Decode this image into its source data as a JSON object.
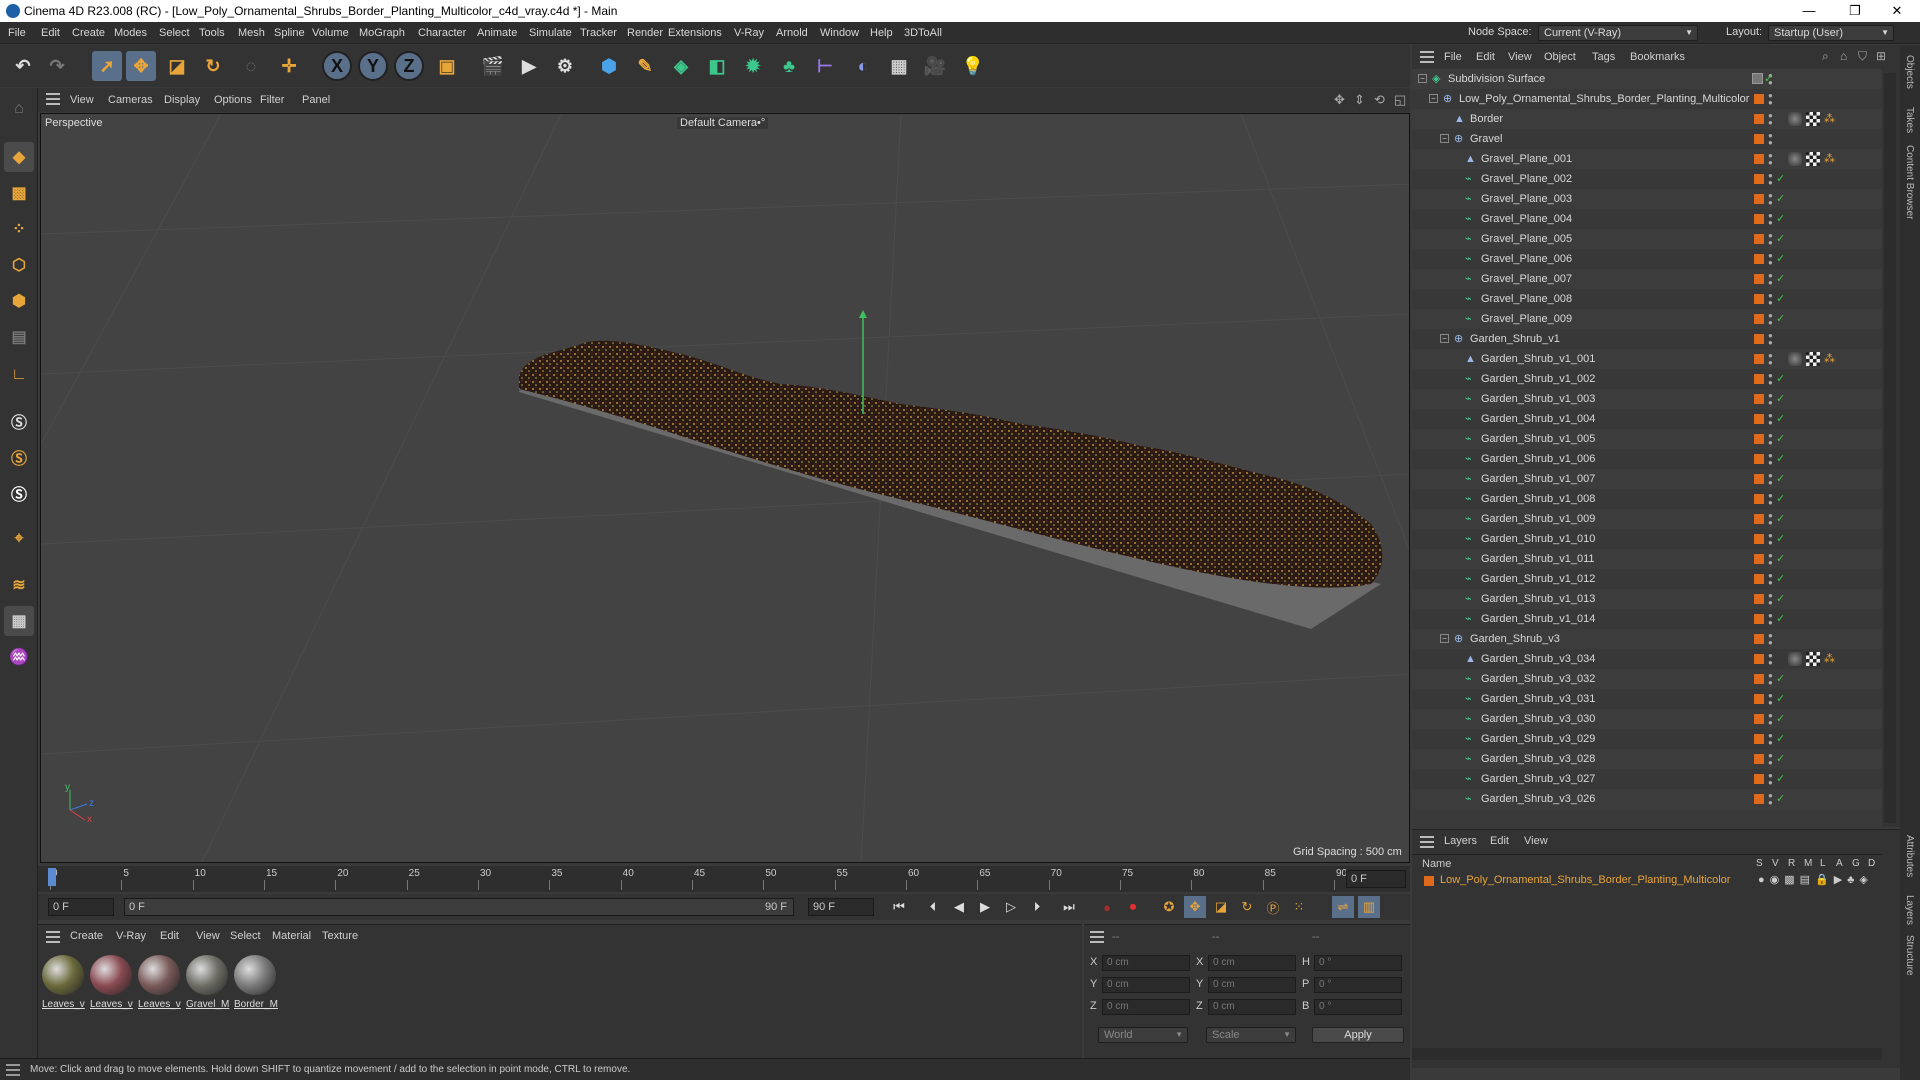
{
  "window": {
    "title": "Cinema 4D R23.008 (RC) - [Low_Poly_Ornamental_Shrubs_Border_Planting_Multicolor_c4d_vray.c4d *] - Main",
    "minimize": "—",
    "maximize": "❐",
    "close": "✕"
  },
  "menu": [
    "File",
    "Edit",
    "Create",
    "Modes",
    "Select",
    "Tools",
    "Mesh",
    "Spline",
    "Volume",
    "MoGraph",
    "Character",
    "Animate",
    "Simulate",
    "Tracker",
    "Render",
    "Extensions",
    "V-Ray",
    "Arnold",
    "Window",
    "Help",
    "3DToAll"
  ],
  "node_space": {
    "label": "Node Space:",
    "value": "Current (V-Ray)"
  },
  "layout": {
    "label": "Layout:",
    "value": "Startup (User)"
  },
  "viewport": {
    "menu": [
      "View",
      "Cameras",
      "Display",
      "Options",
      "Filter",
      "Panel"
    ],
    "label": "Perspective",
    "camera": "Default Camera",
    "camera_suffix": "•°",
    "grid_spacing": "Grid Spacing : 500 cm",
    "axis_y": "y",
    "axis_z": "z",
    "axis_x": "x"
  },
  "timeline": {
    "ticks": [
      "0",
      "5",
      "10",
      "15",
      "20",
      "25",
      "30",
      "35",
      "40",
      "45",
      "50",
      "55",
      "60",
      "65",
      "70",
      "75",
      "80",
      "85",
      "90"
    ],
    "current_frame": "0 F"
  },
  "transport": {
    "start": "0 F",
    "range_start": "0 F",
    "range_end": "90 F",
    "end": "90 F"
  },
  "materials": {
    "menu": [
      "Create",
      "V-Ray",
      "Edit",
      "View",
      "Select",
      "Material",
      "Texture"
    ],
    "items": [
      {
        "label": "Leaves_v",
        "color": "#6b6a3c"
      },
      {
        "label": "Leaves_v",
        "color": "#8a4a52"
      },
      {
        "label": "Leaves_v",
        "color": "#7a5a5a"
      },
      {
        "label": "Gravel_M",
        "color": "#6e6e66"
      },
      {
        "label": "Border_M",
        "color": "#7a7a7a"
      }
    ]
  },
  "coords": {
    "header": [
      "--",
      "--",
      "--"
    ],
    "rows": [
      {
        "a": "X",
        "av": "0 cm",
        "b": "X",
        "bv": "0 cm",
        "c": "H",
        "cv": "0 °"
      },
      {
        "a": "Y",
        "av": "0 cm",
        "b": "Y",
        "bv": "0 cm",
        "c": "P",
        "cv": "0 °"
      },
      {
        "a": "Z",
        "av": "0 cm",
        "b": "Z",
        "bv": "0 cm",
        "c": "B",
        "cv": "0 °"
      }
    ],
    "mode1": "World",
    "mode2": "Scale",
    "apply": "Apply"
  },
  "status": "Move: Click and drag to move elements. Hold down SHIFT to quantize movement / add to the selection in point mode, CTRL to remove.",
  "objects": {
    "menu": [
      "File",
      "Edit",
      "View",
      "Object",
      "Tags",
      "Bookmarks"
    ],
    "rows": [
      {
        "name": "Subdivision Surface",
        "indent": 0,
        "icon": "subdiv",
        "toggle": "minus"
      },
      {
        "name": "Low_Poly_Ornamental_Shrubs_Border_Planting_Multicolor",
        "indent": 1,
        "icon": "null",
        "toggle": "minus"
      },
      {
        "name": "Border",
        "indent": 2,
        "icon": "poly",
        "tags": true
      },
      {
        "name": "Gravel",
        "indent": 2,
        "icon": "null",
        "toggle": "minus"
      },
      {
        "name": "Gravel_Plane_001",
        "indent": 3,
        "icon": "poly",
        "tags": true
      },
      {
        "name": "Gravel_Plane_002",
        "indent": 3,
        "icon": "inst"
      },
      {
        "name": "Gravel_Plane_003",
        "indent": 3,
        "icon": "inst"
      },
      {
        "name": "Gravel_Plane_004",
        "indent": 3,
        "icon": "inst"
      },
      {
        "name": "Gravel_Plane_005",
        "indent": 3,
        "icon": "inst"
      },
      {
        "name": "Gravel_Plane_006",
        "indent": 3,
        "icon": "inst"
      },
      {
        "name": "Gravel_Plane_007",
        "indent": 3,
        "icon": "inst"
      },
      {
        "name": "Gravel_Plane_008",
        "indent": 3,
        "icon": "inst"
      },
      {
        "name": "Gravel_Plane_009",
        "indent": 3,
        "icon": "inst"
      },
      {
        "name": "Garden_Shrub_v1",
        "indent": 2,
        "icon": "null",
        "toggle": "minus"
      },
      {
        "name": "Garden_Shrub_v1_001",
        "indent": 3,
        "icon": "poly",
        "tags": true
      },
      {
        "name": "Garden_Shrub_v1_002",
        "indent": 3,
        "icon": "inst"
      },
      {
        "name": "Garden_Shrub_v1_003",
        "indent": 3,
        "icon": "inst"
      },
      {
        "name": "Garden_Shrub_v1_004",
        "indent": 3,
        "icon": "inst"
      },
      {
        "name": "Garden_Shrub_v1_005",
        "indent": 3,
        "icon": "inst"
      },
      {
        "name": "Garden_Shrub_v1_006",
        "indent": 3,
        "icon": "inst"
      },
      {
        "name": "Garden_Shrub_v1_007",
        "indent": 3,
        "icon": "inst"
      },
      {
        "name": "Garden_Shrub_v1_008",
        "indent": 3,
        "icon": "inst"
      },
      {
        "name": "Garden_Shrub_v1_009",
        "indent": 3,
        "icon": "inst"
      },
      {
        "name": "Garden_Shrub_v1_010",
        "indent": 3,
        "icon": "inst"
      },
      {
        "name": "Garden_Shrub_v1_011",
        "indent": 3,
        "icon": "inst"
      },
      {
        "name": "Garden_Shrub_v1_012",
        "indent": 3,
        "icon": "inst"
      },
      {
        "name": "Garden_Shrub_v1_013",
        "indent": 3,
        "icon": "inst"
      },
      {
        "name": "Garden_Shrub_v1_014",
        "indent": 3,
        "icon": "inst"
      },
      {
        "name": "Garden_Shrub_v3",
        "indent": 2,
        "icon": "null",
        "toggle": "minus"
      },
      {
        "name": "Garden_Shrub_v3_034",
        "indent": 3,
        "icon": "poly",
        "tags": true
      },
      {
        "name": "Garden_Shrub_v3_032",
        "indent": 3,
        "icon": "inst"
      },
      {
        "name": "Garden_Shrub_v3_031",
        "indent": 3,
        "icon": "inst"
      },
      {
        "name": "Garden_Shrub_v3_030",
        "indent": 3,
        "icon": "inst"
      },
      {
        "name": "Garden_Shrub_v3_029",
        "indent": 3,
        "icon": "inst"
      },
      {
        "name": "Garden_Shrub_v3_028",
        "indent": 3,
        "icon": "inst"
      },
      {
        "name": "Garden_Shrub_v3_027",
        "indent": 3,
        "icon": "inst"
      },
      {
        "name": "Garden_Shrub_v3_026",
        "indent": 3,
        "icon": "inst"
      }
    ]
  },
  "layers": {
    "menu": [
      "Layers",
      "Edit",
      "View"
    ],
    "name_header": "Name",
    "flags": [
      "S",
      "V",
      "R",
      "M",
      "L",
      "A",
      "G",
      "D"
    ],
    "row": "Low_Poly_Ornamental_Shrubs_Border_Planting_Multicolor",
    "color": "#e06a1c"
  },
  "side_tabs": [
    "Objects",
    "Takes",
    "Content Browser",
    "Attributes",
    "Layers",
    "Structure"
  ]
}
